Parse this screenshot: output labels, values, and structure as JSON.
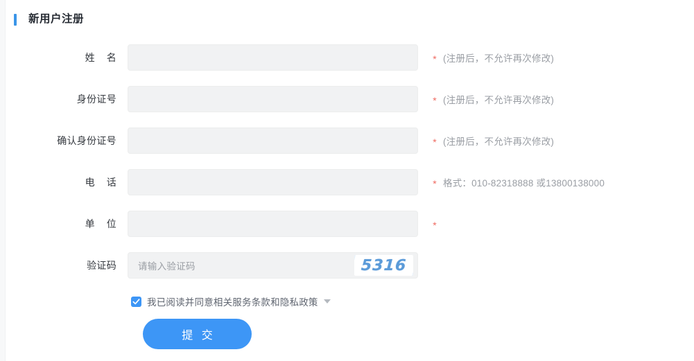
{
  "page": {
    "title": "新用户注册",
    "accent_color": "#3b95e8",
    "primary_color": "#3d96f6",
    "required_color": "#ef6b62",
    "field_background": "#f1f2f3"
  },
  "form": {
    "rows": [
      {
        "label": "姓    名",
        "value": "",
        "placeholder": "",
        "required_mark": "*",
        "hint": "(注册后，不允许再次修改)"
      },
      {
        "label": "身份证号",
        "value": "",
        "placeholder": "",
        "required_mark": "*",
        "hint": "(注册后，不允许再次修改)"
      },
      {
        "label": "确认身份证号",
        "value": "",
        "placeholder": "",
        "required_mark": "*",
        "hint": "(注册后，不允许再次修改)"
      },
      {
        "label": "电    话",
        "value": "",
        "placeholder": "",
        "required_mark": "*",
        "hint": "格式：010-82318888 或13800138000"
      },
      {
        "label": "单    位",
        "value": "",
        "placeholder": "",
        "required_mark": "*",
        "hint": ""
      }
    ],
    "captcha": {
      "label": "验证码",
      "placeholder": "请输入验证码",
      "value": "",
      "code": "5316",
      "code_color": "#5b9bd9"
    },
    "agreement": {
      "checked": true,
      "text": "我已阅读并同意相关服务条款和隐私政策",
      "caret_icon": "chevron-down-icon"
    },
    "submit": {
      "label": "提 交"
    }
  }
}
